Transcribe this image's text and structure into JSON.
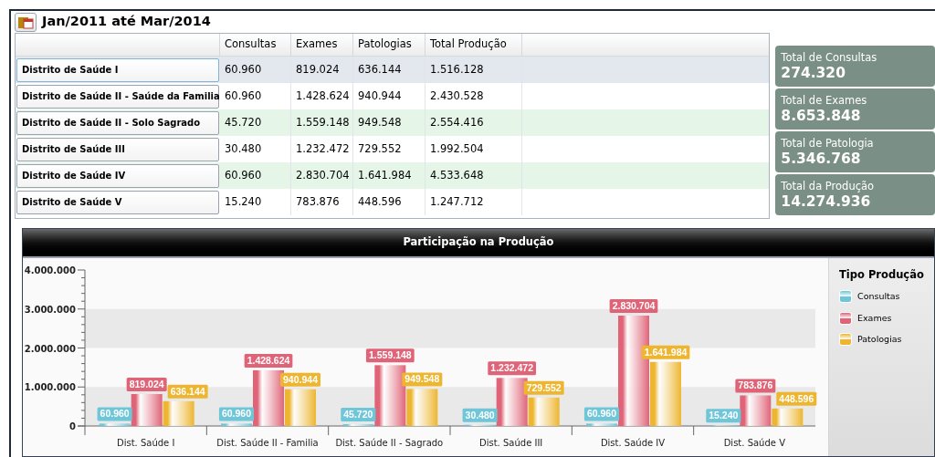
{
  "header": {
    "title": "Jan/2011 até Mar/2014"
  },
  "table": {
    "columns": [
      "Consultas",
      "Exames",
      "Patologias",
      "Total Produção"
    ],
    "rows": [
      {
        "name": "Distrito de Saúde I",
        "selected": true,
        "cells": [
          "60.960",
          "819.024",
          "636.144",
          "1.516.128"
        ]
      },
      {
        "name": "Distrito de Saúde II - Saúde da Familia",
        "selected": false,
        "cells": [
          "60.960",
          "1.428.624",
          "940.944",
          "2.430.528"
        ]
      },
      {
        "name": "Distrito de Saúde II - Solo Sagrado",
        "selected": false,
        "cells": [
          "45.720",
          "1.559.148",
          "949.548",
          "2.554.416"
        ]
      },
      {
        "name": "Distrito de Saúde III",
        "selected": false,
        "cells": [
          "30.480",
          "1.232.472",
          "729.552",
          "1.992.504"
        ]
      },
      {
        "name": "Distrito de Saúde IV",
        "selected": false,
        "cells": [
          "60.960",
          "2.830.704",
          "1.641.984",
          "4.533.648"
        ]
      },
      {
        "name": "Distrito de Saúde V",
        "selected": false,
        "cells": [
          "15.240",
          "783.876",
          "448.596",
          "1.247.712"
        ]
      }
    ]
  },
  "totals": [
    {
      "label": "Total de Consultas",
      "value": "274.320"
    },
    {
      "label": "Total de Exames",
      "value": "8.653.848"
    },
    {
      "label": "Total de Patologia",
      "value": "5.346.768"
    },
    {
      "label": "Total da Produção",
      "value": "14.274.936"
    }
  ],
  "chart": {
    "title": "Participação na Produção",
    "legend_title": "Tipo Produção",
    "chart_data": {
      "type": "bar",
      "categories": [
        "Dist. Saúde I",
        "Dist. Saúde II - Familia",
        "Dist. Saúde II - Sagrado",
        "Dist. Saúde III",
        "Dist. Saúde IV",
        "Dist. Saúde V"
      ],
      "series": [
        {
          "name": "Consultas",
          "color": "#6ec6d8",
          "values": [
            60960,
            60960,
            45720,
            30480,
            60960,
            15240
          ],
          "value_labels": [
            "60.960",
            "60.960",
            "45.720",
            "30.480",
            "60.960",
            "15.240"
          ]
        },
        {
          "name": "Exames",
          "color": "#e06478",
          "values": [
            819024,
            1428624,
            1559148,
            1232472,
            2830704,
            783876
          ],
          "value_labels": [
            "819.024",
            "1.428.624",
            "1.559.148",
            "1.232.472",
            "2.830.704",
            "783.876"
          ]
        },
        {
          "name": "Patologias",
          "color": "#eeb630",
          "values": [
            636144,
            940944,
            949548,
            729552,
            1641984,
            448596
          ],
          "value_labels": [
            "636.144",
            "940.944",
            "949.548",
            "729.552",
            "1.641.984",
            "448.596"
          ]
        }
      ],
      "ylim": [
        0,
        4000000
      ],
      "yticks": [
        {
          "value": 0,
          "label": "0"
        },
        {
          "value": 1000000,
          "label": "1.000.000"
        },
        {
          "value": 2000000,
          "label": "2.000.000"
        },
        {
          "value": 3000000,
          "label": "3.000.000"
        },
        {
          "value": 4000000,
          "label": "4.000.000"
        }
      ],
      "data_labels": true
    }
  }
}
